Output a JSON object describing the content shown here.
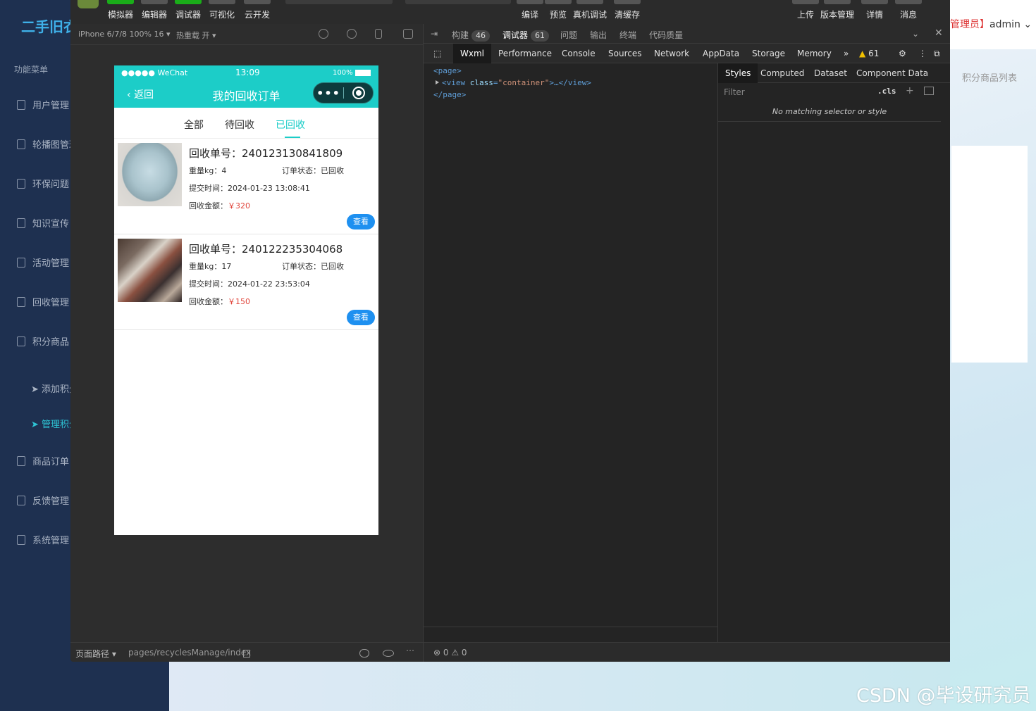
{
  "background_app": {
    "logo": "二手旧衣",
    "menu_title": "功能菜单",
    "menu_items": [
      "用户管理",
      "轮播图管理",
      "环保问题",
      "知识宣传",
      "活动管理",
      "回收管理",
      "积分商品"
    ],
    "sub_items": [
      "添加积分商品",
      "管理积分商品"
    ],
    "menu_items_after": [
      "商品订单",
      "反馈管理",
      "系统管理"
    ],
    "admin_prefix": "管理员】",
    "admin_name": "admin",
    "breadcrumb": "积分商品列表"
  },
  "toolbar": {
    "buttons": [
      "模拟器",
      "编辑器",
      "调试器",
      "可视化",
      "云开发"
    ],
    "compile_buttons": [
      "编译",
      "预览",
      "真机调试",
      "清缓存"
    ],
    "right_buttons": [
      "上传",
      "版本管理",
      "详情",
      "消息"
    ]
  },
  "simulator": {
    "device": "iPhone 6/7/8 100% 16",
    "hot_reload": "热重载 开",
    "footer_path_label": "页面路径",
    "footer_path": "pages/recyclesManage/index"
  },
  "phone": {
    "status_left": "●●●●● WeChat",
    "status_time": "13:09",
    "status_battery": "100%",
    "back_label": "返回",
    "title": "我的回收订单",
    "capsule_dots": "•••",
    "tabs": [
      "全部",
      "待回收",
      "已回收"
    ],
    "active_tab": "已回收",
    "orders": [
      {
        "order_no_label": "回收单号：240123130841809",
        "weight": "重量kg：4",
        "status": "订单状态：已回收",
        "time": "提交时间：2024-01-23 13:08:41",
        "amount_label": "回收金额：",
        "amount": "￥320",
        "button": "查看"
      },
      {
        "order_no_label": "回收单号：240122235304068",
        "weight": "重量kg：17",
        "status": "订单状态：已回收",
        "time": "提交时间：2024-01-22 23:53:04",
        "amount_label": "回收金额：",
        "amount": "￥150",
        "button": "查看"
      }
    ]
  },
  "devtools": {
    "top_tabs": [
      "构建",
      "调试器",
      "问题",
      "输出",
      "终端",
      "代码质量"
    ],
    "build_count": "46",
    "debug_count": "61",
    "panel_tabs": [
      "Wxml",
      "Performance",
      "Console",
      "Sources",
      "Network",
      "AppData",
      "Storage",
      "Memory"
    ],
    "more": "»",
    "warning_count": "61",
    "wxml_lines": [
      "<page>",
      "<view class=\"container\">…</view>",
      "</page>"
    ],
    "style_tabs": [
      "Styles",
      "Computed",
      "Dataset",
      "Component Data"
    ],
    "filter_placeholder": "Filter",
    "cls": ".cls",
    "no_match": "No matching selector or style",
    "footer_status": "⊗ 0 ⚠ 0"
  },
  "watermark": "CSDN @毕设研究员"
}
